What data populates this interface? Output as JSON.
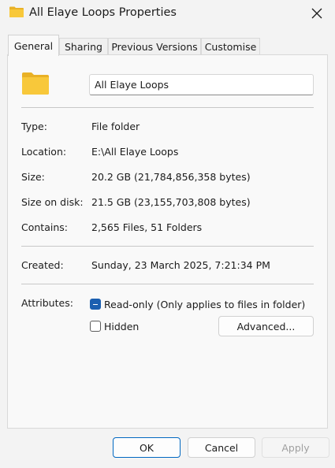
{
  "window": {
    "title": "All Elaye Loops Properties",
    "icon": "folder-icon",
    "close_icon": "close-icon"
  },
  "tabs": [
    {
      "label": "General",
      "active": true
    },
    {
      "label": "Sharing",
      "active": false
    },
    {
      "label": "Previous Versions",
      "active": false
    },
    {
      "label": "Customise",
      "active": false
    }
  ],
  "general": {
    "folder_icon": "folder-icon",
    "name": "All Elaye Loops",
    "type_label": "Type:",
    "type_value": "File folder",
    "location_label": "Location:",
    "location_value": "E:\\All Elaye Loops",
    "size_label": "Size:",
    "size_value": "20.2 GB (21,784,856,358 bytes)",
    "size_on_disk_label": "Size on disk:",
    "size_on_disk_value": "21.5 GB (23,155,703,808 bytes)",
    "contains_label": "Contains:",
    "contains_value": "2,565 Files, 51 Folders",
    "created_label": "Created:",
    "created_value": "Sunday, 23 March 2025, 7:21:34 PM",
    "attributes_label": "Attributes:",
    "readonly_label": "Read-only (Only applies to files in folder)",
    "readonly_state": "indeterminate",
    "hidden_label": "Hidden",
    "hidden_state": "unchecked",
    "advanced_label": "Advanced..."
  },
  "footer": {
    "ok_label": "OK",
    "cancel_label": "Cancel",
    "apply_label": "Apply",
    "apply_enabled": false
  },
  "colors": {
    "accent": "#1b5fb0",
    "primary_border": "#0067c0",
    "folder": "#f8c83a"
  }
}
